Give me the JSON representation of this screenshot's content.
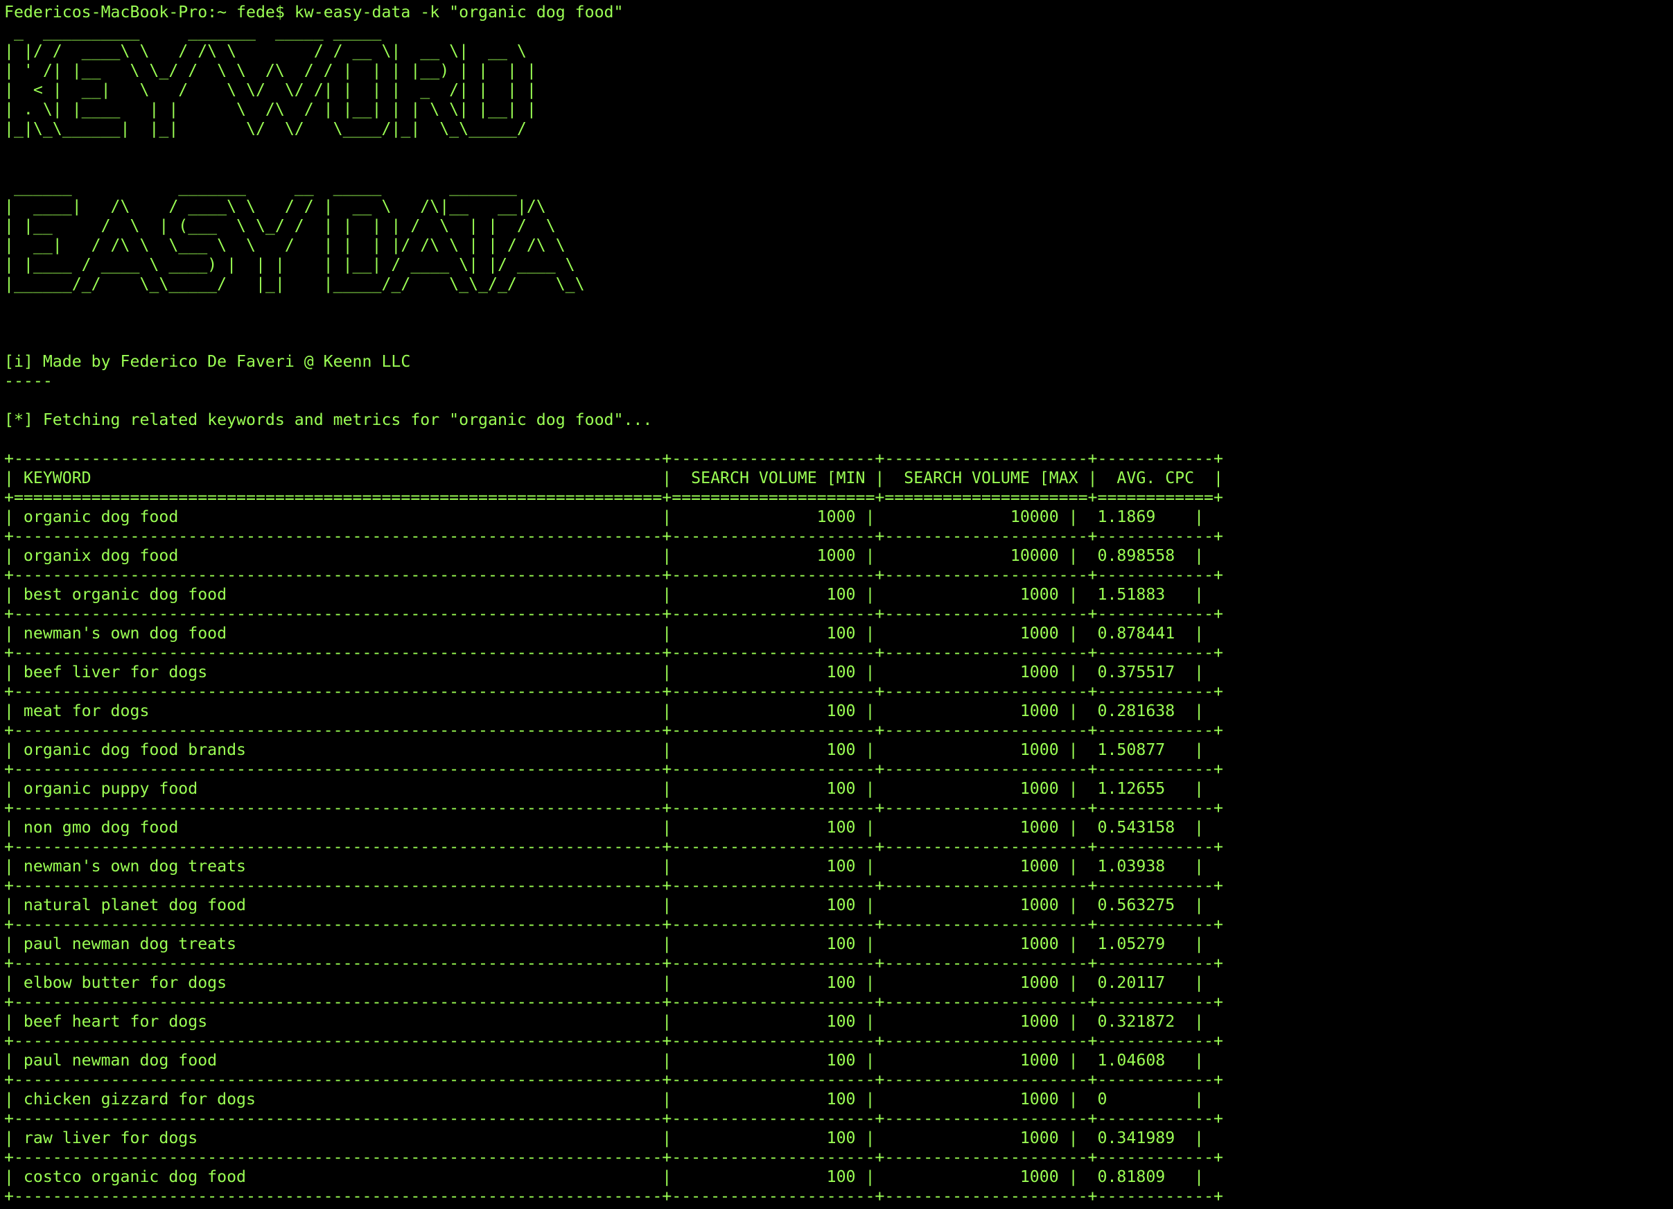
{
  "terminal": {
    "text_color": "#9bff54",
    "background": "#000000",
    "prompt": "Federicos-MacBook-Pro:~ fede$ ",
    "command": "kw-easy-data -k \"organic dog food\""
  },
  "banner": {
    "keyword_art": " _  __________     _______  _____ _____  \n| |/ /  ____\\ \\   / /\\ \\        / / __ \\|  __ \\|  __ \\ \n| ' /| |__   \\ \\_/ /  \\ \\  /\\  / / |  | | |__) | |  | |\n|  < |  __|   \\   /    \\ \\/  \\/ /| |  | |  _  /| |  | |\n| . \\| |____   | |      \\  /\\  / | |__| | | \\ \\| |__| |\n|_|\\_\\______|  |_|       \\/  \\/   \\____/|_|  \\_\\_____/ ",
    "easydata_art": " ______           _______     __  _____       _______        \n|  ____|   /\\    / ____\\ \\   / / |  __ \\   /\\|__   __|/\\     \n| |__     /  \\  | (___  \\ \\_/ /  | |  | | /  \\  | |  /  \\    \n|  __|   / /\\ \\  \\___ \\  \\   /   | |  | |/ /\\ \\ | | / /\\ \\   \n| |____ / ____ \\ ____) |  | |    | |__| / ____ \\| |/ ____ \\  \n|______/_/    \\_\\_____/   |_|    |_____/_/    \\_\\_/_/    \\_\\ "
  },
  "info_line": "[i] Made by Federico De Faveri @ Keenn LLC",
  "separator": "-----",
  "status_line": "[*] Fetching related keywords and metrics for \"organic dog food\"...",
  "table": {
    "columns": [
      "KEYWORD",
      "SEARCH VOLUME [MIN]",
      "SEARCH VOLUME [MAX]",
      "AVG. CPC"
    ],
    "rows": [
      {
        "keyword": "organic dog food",
        "min": "1000",
        "max": "10000",
        "cpc": "1.1869"
      },
      {
        "keyword": "organix dog food",
        "min": "1000",
        "max": "10000",
        "cpc": "0.898558"
      },
      {
        "keyword": "best organic dog food",
        "min": "100",
        "max": "1000",
        "cpc": "1.51883"
      },
      {
        "keyword": "newman's own dog food",
        "min": "100",
        "max": "1000",
        "cpc": "0.878441"
      },
      {
        "keyword": "beef liver for dogs",
        "min": "100",
        "max": "1000",
        "cpc": "0.375517"
      },
      {
        "keyword": "meat for dogs",
        "min": "100",
        "max": "1000",
        "cpc": "0.281638"
      },
      {
        "keyword": "organic dog food brands",
        "min": "100",
        "max": "1000",
        "cpc": "1.50877"
      },
      {
        "keyword": "organic puppy food",
        "min": "100",
        "max": "1000",
        "cpc": "1.12655"
      },
      {
        "keyword": "non gmo dog food",
        "min": "100",
        "max": "1000",
        "cpc": "0.543158"
      },
      {
        "keyword": "newman's own dog treats",
        "min": "100",
        "max": "1000",
        "cpc": "1.03938"
      },
      {
        "keyword": "natural planet dog food",
        "min": "100",
        "max": "1000",
        "cpc": "0.563275"
      },
      {
        "keyword": "paul newman dog treats",
        "min": "100",
        "max": "1000",
        "cpc": "1.05279"
      },
      {
        "keyword": "elbow butter for dogs",
        "min": "100",
        "max": "1000",
        "cpc": "0.20117"
      },
      {
        "keyword": "beef heart for dogs",
        "min": "100",
        "max": "1000",
        "cpc": "0.321872"
      },
      {
        "keyword": "paul newman dog food",
        "min": "100",
        "max": "1000",
        "cpc": "1.04608"
      },
      {
        "keyword": "chicken gizzard for dogs",
        "min": "100",
        "max": "1000",
        "cpc": "0"
      },
      {
        "keyword": "raw liver for dogs",
        "min": "100",
        "max": "1000",
        "cpc": "0.341989"
      },
      {
        "keyword": "costco organic dog food",
        "min": "100",
        "max": "1000",
        "cpc": "0.81809"
      }
    ]
  }
}
